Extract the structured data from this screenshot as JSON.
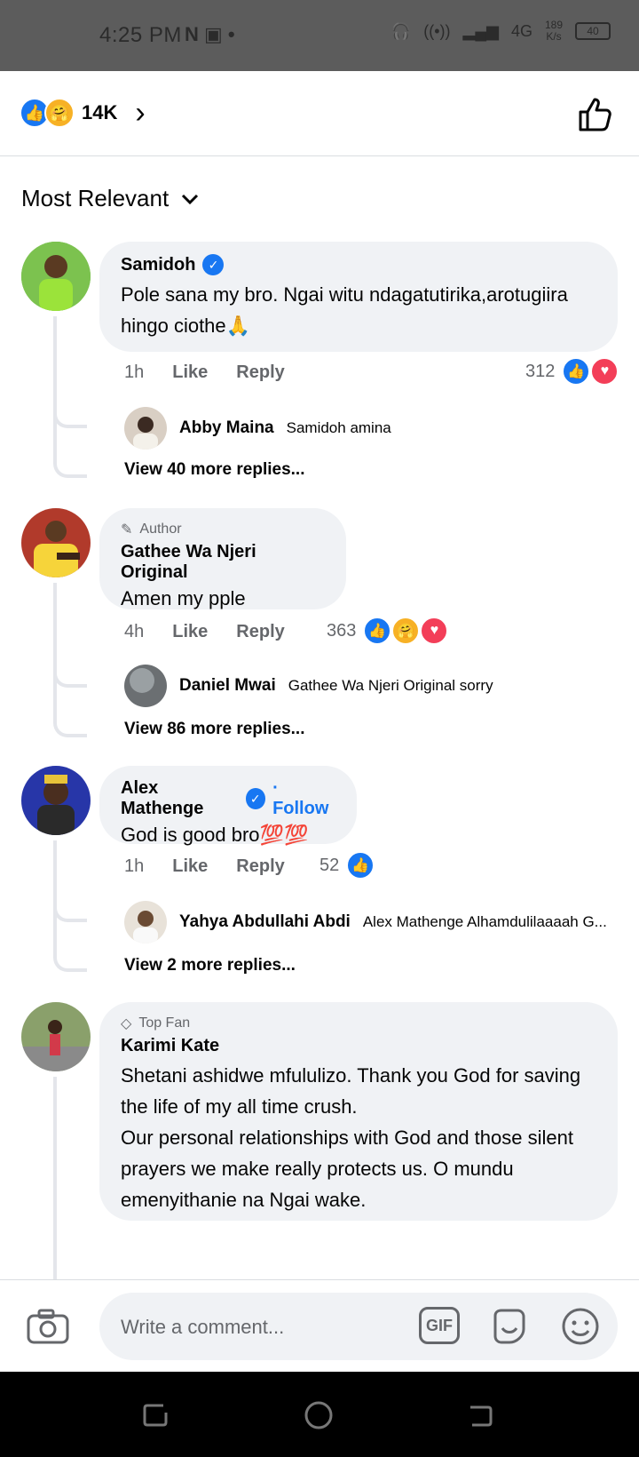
{
  "status_bar": {
    "time": "4:25 PM",
    "left_icons": "N ▣ •",
    "network": "4G",
    "speed_value": "189",
    "speed_unit": "K/s",
    "battery": "40"
  },
  "reactions_header": {
    "count": "14K",
    "icons": [
      "like-icon",
      "care-icon"
    ]
  },
  "sort": {
    "label": "Most Relevant"
  },
  "comments": [
    {
      "name": "Samidoh",
      "verified": true,
      "text": "Pole sana my bro. Ngai witu ndagatutirika,arotugiira hingo ciothe🙏",
      "time": "1h",
      "like": "Like",
      "reply": "Reply",
      "reaction_count": "312",
      "reply_preview": {
        "name": "Abby Maina",
        "text": "Samidoh amina"
      },
      "view_more": "View 40 more replies..."
    },
    {
      "tag": "Author",
      "name": "Gathee Wa Njeri Original",
      "text": "Amen my pple",
      "time": "4h",
      "like": "Like",
      "reply": "Reply",
      "reaction_count": "363",
      "reply_preview": {
        "name": "Daniel Mwai",
        "text": "Gathee Wa Njeri Original sorry"
      },
      "view_more": "View 86 more replies..."
    },
    {
      "name": "Alex Mathenge",
      "verified": true,
      "follow": "· Follow",
      "text": "God is good bro💯💯",
      "time": "1h",
      "like": "Like",
      "reply": "Reply",
      "reaction_count": "52",
      "reply_preview": {
        "name": "Yahya Abdullahi Abdi",
        "text": "Alex Mathenge Alhamdulilaaaah G..."
      },
      "view_more": "View 2 more replies..."
    },
    {
      "tag": "Top Fan",
      "name": "Karimi Kate",
      "text": "Shetani ashidwe mfululizo. Thank you God for saving the life of my all time crush.\nOur personal relationships with God and those silent prayers we make really protects us. O mundu emenyithanie na Ngai wake."
    }
  ],
  "composer": {
    "placeholder": "Write a comment...",
    "gif_label": "GIF"
  },
  "colors": {
    "accent": "#1877f2",
    "bubble": "#f0f2f5",
    "love": "#f33e58",
    "care": "#f7b125"
  }
}
